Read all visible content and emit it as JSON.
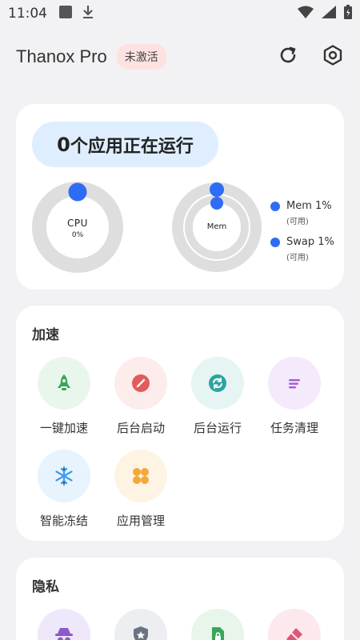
{
  "status_bar": {
    "time": "11:04"
  },
  "app_bar": {
    "title": "Thanox Pro",
    "badge": "未激活"
  },
  "status_card": {
    "running_count": "0",
    "running_text": "个应用正在运行",
    "cpu": {
      "label": "CPU",
      "value": "0%"
    },
    "mem": {
      "label": "Mem"
    },
    "legend": [
      {
        "name": "Mem 1%",
        "sub": "(可用)"
      },
      {
        "name": "Swap 1%",
        "sub": "(可用)"
      }
    ]
  },
  "speed_section": {
    "title": "加速",
    "items": [
      {
        "label": "一键加速",
        "icon": "rocket-icon"
      },
      {
        "label": "后台启动",
        "icon": "no-entry-icon"
      },
      {
        "label": "后台运行",
        "icon": "sync-icon"
      },
      {
        "label": "任务清理",
        "icon": "list-clean-icon"
      },
      {
        "label": "智能冻结",
        "icon": "snowflake-icon"
      },
      {
        "label": "应用管理",
        "icon": "apps-grid-icon"
      }
    ]
  },
  "privacy_section": {
    "title": "隐私",
    "items": [
      {
        "icon": "incognito-icon"
      },
      {
        "icon": "shield-star-icon"
      },
      {
        "icon": "lock-file-icon"
      },
      {
        "icon": "eraser-icon"
      }
    ]
  },
  "colors": {
    "accent": "#2f6cf6",
    "gauge_track": "#dedede",
    "badge_bg": "#fde2e2",
    "pill_bg": "#deeefe"
  }
}
